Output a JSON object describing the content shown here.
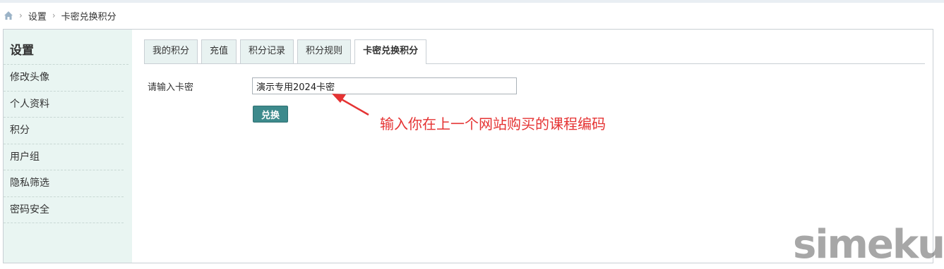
{
  "breadcrumb": {
    "home_icon": "home-icon",
    "items": [
      "设置",
      "卡密兑换积分"
    ]
  },
  "sidebar": {
    "title": "设置",
    "items": [
      {
        "label": "修改头像"
      },
      {
        "label": "个人资料"
      },
      {
        "label": "积分"
      },
      {
        "label": "用户组"
      },
      {
        "label": "隐私筛选"
      },
      {
        "label": "密码安全"
      }
    ]
  },
  "tabs": [
    {
      "label": "我的积分"
    },
    {
      "label": "充值"
    },
    {
      "label": "积分记录"
    },
    {
      "label": "积分规则"
    },
    {
      "label": "卡密兑换积分",
      "active": true
    }
  ],
  "form": {
    "label": "请输入卡密",
    "input_value": "演示专用2024卡密",
    "submit_label": "兑换"
  },
  "annotation": {
    "text": "输入你在上一个网站购买的课程编码",
    "color": "#e53333"
  },
  "watermark": "simeku.cn",
  "colors": {
    "sidebar_bg": "#e9f5f2",
    "button_bg": "#3d8a8c"
  }
}
